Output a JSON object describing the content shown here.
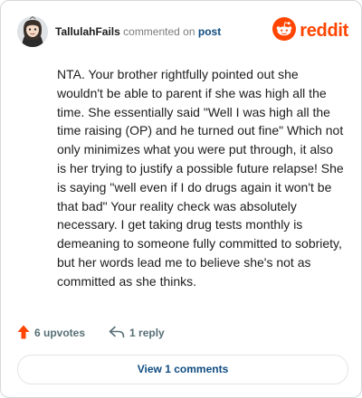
{
  "comment": {
    "author": "TallulahFails",
    "action_text": "commented on",
    "target_link": "post",
    "body": "NTA. Your brother rightfully pointed out she wouldn't be able to parent if she was high all the time. She essentially said \"Well I was high all the time raising (OP) and he turned out fine\" Which not only minimizes what you were put through, it also is her trying to justify a possible future relapse! She is saying \"well even if I do drugs again it won't be that bad\" Your reality check was absolutely necessary. I get taking drug tests monthly is demeaning to someone fully committed to sobriety, but her words lead me to believe she's not as committed as she thinks."
  },
  "brand": {
    "name": "reddit",
    "icon": "reddit-snoo-icon",
    "color": "#ff4500"
  },
  "actions": {
    "upvotes_label": "6 upvotes",
    "upvote_icon": "upvote-arrow-icon",
    "upvote_color": "#ff4500",
    "reply_label": "1 reply",
    "reply_icon": "reply-arrow-icon"
  },
  "footer": {
    "view_comments_label": "View 1 comments"
  }
}
